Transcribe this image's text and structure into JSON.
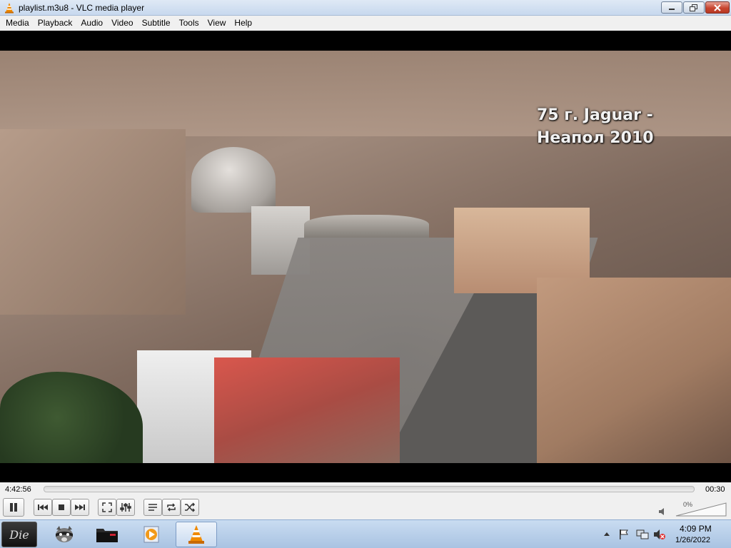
{
  "window": {
    "title": "playlist.m3u8 - VLC media player",
    "icon": "vlc-cone-icon"
  },
  "menu": [
    "Media",
    "Playback",
    "Audio",
    "Video",
    "Subtitle",
    "Tools",
    "View",
    "Help"
  ],
  "video": {
    "overlay_line1": "75 г. Jaguar -",
    "overlay_line2": "Неапол 2010"
  },
  "player": {
    "time_elapsed": "4:42:56",
    "time_total": "00:30",
    "progress": 0,
    "volume_label": "0%",
    "volume": 0,
    "buttons": [
      "pause-icon",
      "previous-icon",
      "stop-icon",
      "next-icon",
      "fullscreen-icon",
      "extended-settings-icon",
      "playlist-icon",
      "loop-icon",
      "shuffle-icon"
    ],
    "accent_color": "#6fa8dc"
  },
  "taskbar": {
    "start_label": "Die",
    "apps": [
      "raccoon-app-icon",
      "folder-app-icon",
      "media-player-app-icon",
      "vlc-app-icon"
    ],
    "clock_time": "4:09 PM",
    "clock_date": "1/26/2022",
    "tray_icons": [
      "show-hidden-icons-chevron",
      "action-center-flag-icon",
      "network-icon",
      "volume-muted-icon"
    ]
  }
}
